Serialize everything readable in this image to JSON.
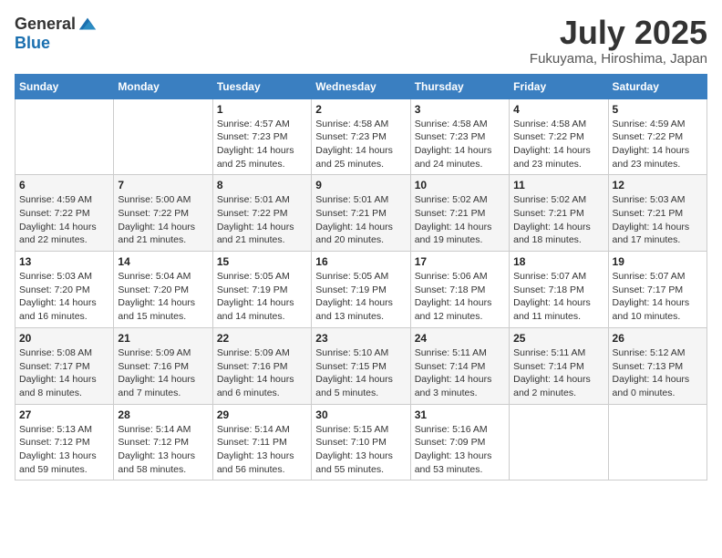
{
  "logo": {
    "general": "General",
    "blue": "Blue"
  },
  "title": {
    "month_year": "July 2025",
    "location": "Fukuyama, Hiroshima, Japan"
  },
  "days_of_week": [
    "Sunday",
    "Monday",
    "Tuesday",
    "Wednesday",
    "Thursday",
    "Friday",
    "Saturday"
  ],
  "weeks": [
    [
      {
        "day": null
      },
      {
        "day": null
      },
      {
        "day": 1,
        "sunrise": "4:57 AM",
        "sunset": "7:23 PM",
        "daylight": "14 hours and 25 minutes."
      },
      {
        "day": 2,
        "sunrise": "4:58 AM",
        "sunset": "7:23 PM",
        "daylight": "14 hours and 25 minutes."
      },
      {
        "day": 3,
        "sunrise": "4:58 AM",
        "sunset": "7:23 PM",
        "daylight": "14 hours and 24 minutes."
      },
      {
        "day": 4,
        "sunrise": "4:58 AM",
        "sunset": "7:22 PM",
        "daylight": "14 hours and 23 minutes."
      },
      {
        "day": 5,
        "sunrise": "4:59 AM",
        "sunset": "7:22 PM",
        "daylight": "14 hours and 23 minutes."
      }
    ],
    [
      {
        "day": 6,
        "sunrise": "4:59 AM",
        "sunset": "7:22 PM",
        "daylight": "14 hours and 22 minutes."
      },
      {
        "day": 7,
        "sunrise": "5:00 AM",
        "sunset": "7:22 PM",
        "daylight": "14 hours and 21 minutes."
      },
      {
        "day": 8,
        "sunrise": "5:01 AM",
        "sunset": "7:22 PM",
        "daylight": "14 hours and 21 minutes."
      },
      {
        "day": 9,
        "sunrise": "5:01 AM",
        "sunset": "7:21 PM",
        "daylight": "14 hours and 20 minutes."
      },
      {
        "day": 10,
        "sunrise": "5:02 AM",
        "sunset": "7:21 PM",
        "daylight": "14 hours and 19 minutes."
      },
      {
        "day": 11,
        "sunrise": "5:02 AM",
        "sunset": "7:21 PM",
        "daylight": "14 hours and 18 minutes."
      },
      {
        "day": 12,
        "sunrise": "5:03 AM",
        "sunset": "7:21 PM",
        "daylight": "14 hours and 17 minutes."
      }
    ],
    [
      {
        "day": 13,
        "sunrise": "5:03 AM",
        "sunset": "7:20 PM",
        "daylight": "14 hours and 16 minutes."
      },
      {
        "day": 14,
        "sunrise": "5:04 AM",
        "sunset": "7:20 PM",
        "daylight": "14 hours and 15 minutes."
      },
      {
        "day": 15,
        "sunrise": "5:05 AM",
        "sunset": "7:19 PM",
        "daylight": "14 hours and 14 minutes."
      },
      {
        "day": 16,
        "sunrise": "5:05 AM",
        "sunset": "7:19 PM",
        "daylight": "14 hours and 13 minutes."
      },
      {
        "day": 17,
        "sunrise": "5:06 AM",
        "sunset": "7:18 PM",
        "daylight": "14 hours and 12 minutes."
      },
      {
        "day": 18,
        "sunrise": "5:07 AM",
        "sunset": "7:18 PM",
        "daylight": "14 hours and 11 minutes."
      },
      {
        "day": 19,
        "sunrise": "5:07 AM",
        "sunset": "7:17 PM",
        "daylight": "14 hours and 10 minutes."
      }
    ],
    [
      {
        "day": 20,
        "sunrise": "5:08 AM",
        "sunset": "7:17 PM",
        "daylight": "14 hours and 8 minutes."
      },
      {
        "day": 21,
        "sunrise": "5:09 AM",
        "sunset": "7:16 PM",
        "daylight": "14 hours and 7 minutes."
      },
      {
        "day": 22,
        "sunrise": "5:09 AM",
        "sunset": "7:16 PM",
        "daylight": "14 hours and 6 minutes."
      },
      {
        "day": 23,
        "sunrise": "5:10 AM",
        "sunset": "7:15 PM",
        "daylight": "14 hours and 5 minutes."
      },
      {
        "day": 24,
        "sunrise": "5:11 AM",
        "sunset": "7:14 PM",
        "daylight": "14 hours and 3 minutes."
      },
      {
        "day": 25,
        "sunrise": "5:11 AM",
        "sunset": "7:14 PM",
        "daylight": "14 hours and 2 minutes."
      },
      {
        "day": 26,
        "sunrise": "5:12 AM",
        "sunset": "7:13 PM",
        "daylight": "14 hours and 0 minutes."
      }
    ],
    [
      {
        "day": 27,
        "sunrise": "5:13 AM",
        "sunset": "7:12 PM",
        "daylight": "13 hours and 59 minutes."
      },
      {
        "day": 28,
        "sunrise": "5:14 AM",
        "sunset": "7:12 PM",
        "daylight": "13 hours and 58 minutes."
      },
      {
        "day": 29,
        "sunrise": "5:14 AM",
        "sunset": "7:11 PM",
        "daylight": "13 hours and 56 minutes."
      },
      {
        "day": 30,
        "sunrise": "5:15 AM",
        "sunset": "7:10 PM",
        "daylight": "13 hours and 55 minutes."
      },
      {
        "day": 31,
        "sunrise": "5:16 AM",
        "sunset": "7:09 PM",
        "daylight": "13 hours and 53 minutes."
      },
      {
        "day": null
      },
      {
        "day": null
      }
    ]
  ]
}
